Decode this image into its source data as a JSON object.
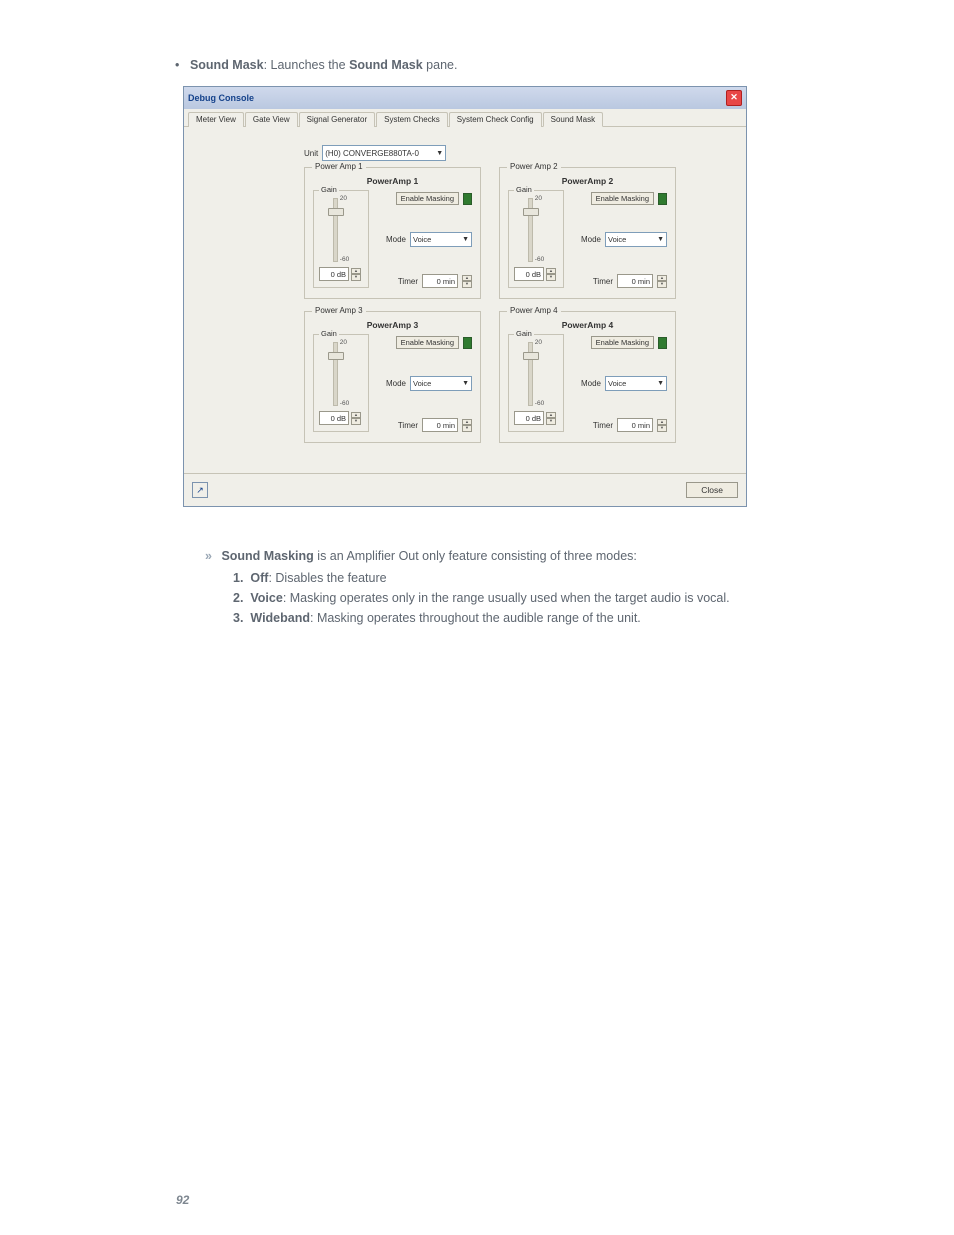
{
  "doc": {
    "bullet_lead_bold": "Sound Mask",
    "bullet_lead_rest": ": Launches the ",
    "bullet_lead_bold2": "Sound Mask",
    "bullet_lead_tail": " pane.",
    "list_lead_pre": "Sound Masking",
    "list_lead_rest": " is an Amplifier Out only feature consisting of three modes:",
    "items": [
      {
        "num": "1.",
        "name": "Off",
        "desc": ": Disables the feature"
      },
      {
        "num": "2.",
        "name": "Voice",
        "desc": ": Masking operates only in the range usually used when the target audio is vocal."
      },
      {
        "num": "3.",
        "name": "Wideband",
        "desc": ": Masking operates throughout the audible range of the unit."
      }
    ],
    "page_number": "92"
  },
  "dialog": {
    "title": "Debug Console",
    "tabs": [
      "Meter View",
      "Gate View",
      "Signal Generator",
      "System Checks",
      "System Check Config",
      "Sound Mask"
    ],
    "active_tab_index": 5,
    "unit_label": "Unit",
    "unit_value": "(H0) CONVERGE880TA-0",
    "close_label": "Close",
    "amps": [
      {
        "group": "Power Amp 1",
        "title": "PowerAmp 1"
      },
      {
        "group": "Power Amp 2",
        "title": "PowerAmp 2"
      },
      {
        "group": "Power Amp 3",
        "title": "PowerAmp 3"
      },
      {
        "group": "Power Amp 4",
        "title": "PowerAmp 4"
      }
    ],
    "amp_common": {
      "gain_legend": "Gain",
      "scale_top": "20",
      "scale_bottom": "-60",
      "gain_value": "0 dB",
      "enable_masking": "Enable Masking",
      "mode_label": "Mode",
      "mode_value": "Voice",
      "timer_label": "Timer",
      "timer_value": "0 min"
    }
  }
}
